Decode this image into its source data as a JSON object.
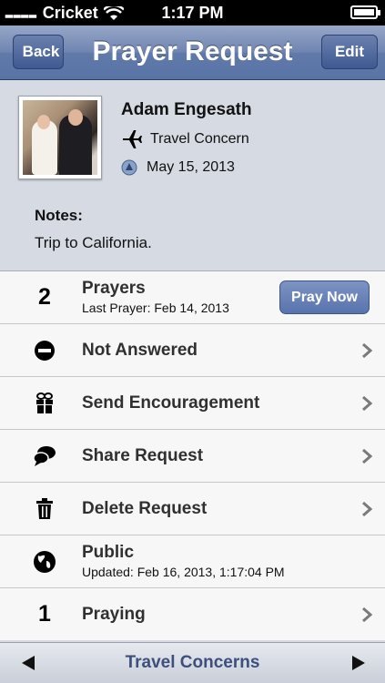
{
  "status_bar": {
    "carrier": "Cricket",
    "time": "1:17 PM",
    "signal_icon": "signal-dots-icon",
    "wifi_icon": "wifi-icon",
    "battery_icon": "battery-charging-icon"
  },
  "nav": {
    "back_label": "Back",
    "title": "Prayer Request",
    "edit_label": "Edit"
  },
  "request": {
    "name": "Adam Engesath",
    "concern": "Travel Concern",
    "concern_icon": "airplane-icon",
    "date": "May 15, 2013",
    "notes_label": "Notes:",
    "notes": "Trip to California."
  },
  "rows": {
    "prayers": {
      "count": "2",
      "label": "Prayers",
      "sub": "Last Prayer: Feb 14, 2013",
      "button": "Pray Now"
    },
    "answered": {
      "label": "Not Answered"
    },
    "encourage": {
      "label": "Send Encouragement"
    },
    "share": {
      "label": "Share Request"
    },
    "delete": {
      "label": "Delete Request"
    },
    "public": {
      "label": "Public",
      "sub": "Updated: Feb 16, 2013, 1:17:04 PM"
    },
    "praying": {
      "count": "1",
      "label": "Praying"
    }
  },
  "toolbar": {
    "title": "Travel Concerns"
  },
  "colors": {
    "nav": "#5874a6",
    "button": "#5873ad",
    "toolbar_text": "#3c4f7d"
  }
}
